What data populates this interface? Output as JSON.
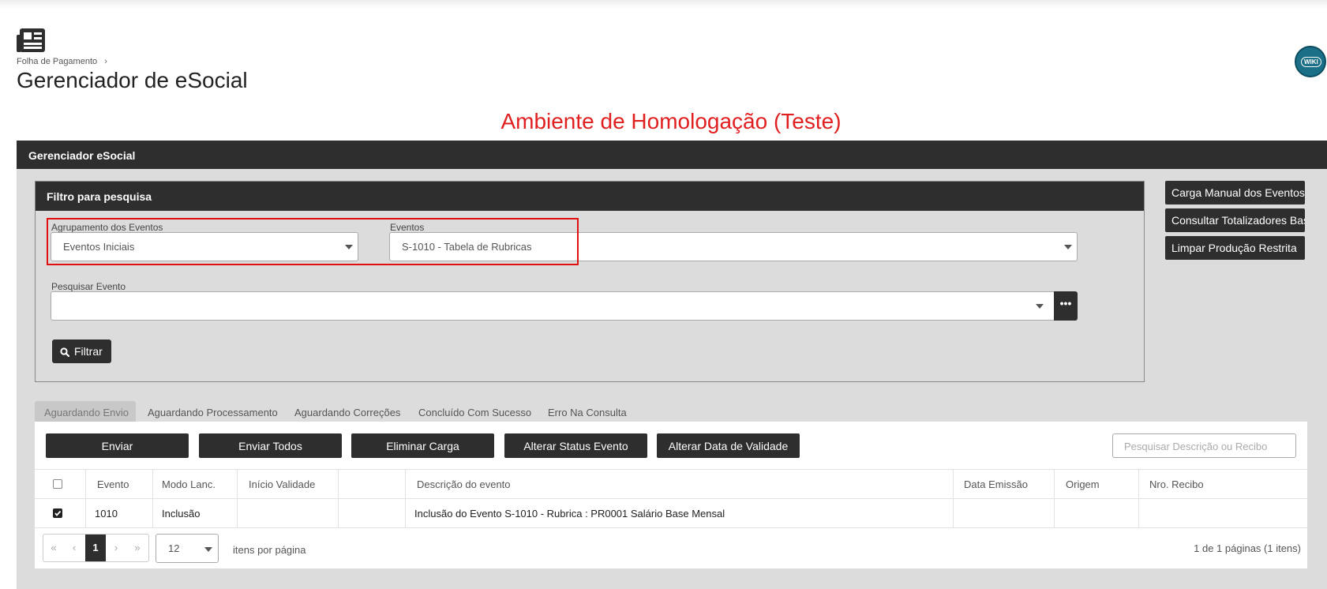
{
  "breadcrumb": {
    "parent": "Folha de Pagamento",
    "separator": "›"
  },
  "page_title": "Gerenciador de eSocial",
  "wiki_label": "WIKI",
  "environment_banner": "Ambiente de Homologação (Teste)",
  "panel": {
    "title": "Gerenciador eSocial"
  },
  "filter": {
    "title": "Filtro para pesquisa",
    "grouping_label": "Agrupamento dos Eventos",
    "grouping_value": "Eventos Iniciais",
    "events_label": "Eventos",
    "events_value": "S-1010 - Tabela de Rubricas",
    "search_label": "Pesquisar Evento",
    "search_value": "",
    "more_label": "•••",
    "filter_button": "Filtrar"
  },
  "side_actions": [
    "Carga Manual dos Eventos",
    "Consultar Totalizadores Base",
    "Limpar Produção Restrita"
  ],
  "tabs": [
    {
      "label": "Aguardando Envio",
      "active": true
    },
    {
      "label": "Aguardando Processamento",
      "active": false
    },
    {
      "label": "Aguardando Correções",
      "active": false
    },
    {
      "label": "Concluído Com Sucesso",
      "active": false
    },
    {
      "label": "Erro Na Consulta",
      "active": false
    }
  ],
  "actions": [
    "Enviar",
    "Enviar Todos",
    "Eliminar Carga",
    "Alterar Status Evento",
    "Alterar Data de Validade"
  ],
  "search_placeholder": "Pesquisar Descrição ou Recibo",
  "table": {
    "columns": [
      "Evento",
      "Modo Lanc.",
      "Início Validade",
      "",
      "Descrição do evento",
      "Data Emissão",
      "Origem",
      "Nro. Recibo"
    ],
    "rows": [
      {
        "checked": true,
        "evento": "1010",
        "modo": "Inclusão",
        "inicio": "",
        "blank": "",
        "descricao": "Inclusão do Evento S-1010 - Rubrica : PR0001 Salário Base Mensal",
        "data_emissao": "",
        "origem": "",
        "recibo": ""
      }
    ]
  },
  "pagination": {
    "first": "«",
    "prev": "‹",
    "current": "1",
    "next": "›",
    "last": "»",
    "per_page": "12",
    "per_page_label": "itens por página",
    "info": "1 de 1 páginas (1 itens)"
  },
  "colors": {
    "dark": "#2e2e2e",
    "panel_bg": "#dcdcdc",
    "alert_red": "#e02020",
    "wiki_teal": "#1b6f86"
  }
}
